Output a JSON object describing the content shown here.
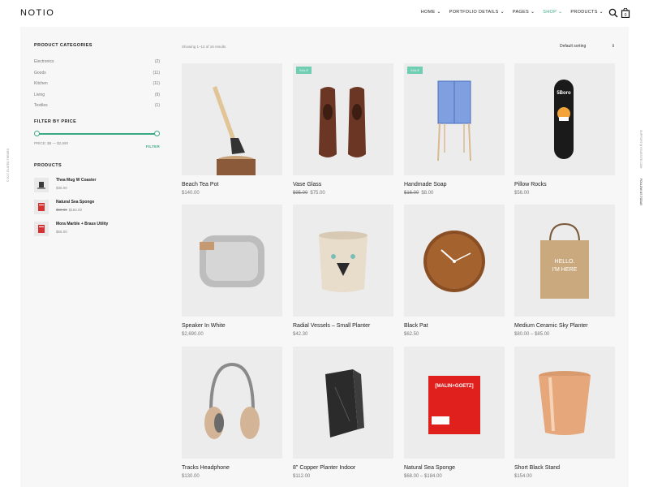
{
  "brand": {
    "logo": "NOTIO"
  },
  "nav": {
    "items": [
      {
        "label": "HOME"
      },
      {
        "label": "PORTFOLIO DETAILS"
      },
      {
        "label": "PAGES"
      },
      {
        "label": "SHOP"
      },
      {
        "label": "PRODUCTS"
      }
    ],
    "active_index": 3
  },
  "side_text": {
    "left": "© 2017 ELATED THEMES",
    "right_top": "SUPPORT@YOURSITE.COM",
    "right_bottom": "FOLLOW US TODAY"
  },
  "sidebar": {
    "categories_title": "PRODUCT CATEGORIES",
    "categories": [
      {
        "name": "Electronics",
        "count": "(2)"
      },
      {
        "name": "Goods",
        "count": "(11)"
      },
      {
        "name": "Kitchen",
        "count": "(11)"
      },
      {
        "name": "Living",
        "count": "(9)"
      },
      {
        "name": "Textiles",
        "count": "(1)"
      }
    ],
    "price_title": "FILTER BY PRICE",
    "price_range": "PRICE: $8 — $2,690",
    "filter_label": "FILTER",
    "products_title": "PRODUCTS",
    "products": [
      {
        "name": "Thea Mug W Coaster",
        "old_price": "",
        "price": "$35.00"
      },
      {
        "name": "Natural Sea Sponge",
        "old_price": "$68.00",
        "price": "$184.00"
      },
      {
        "name": "Mora Marble + Brass Utility",
        "old_price": "",
        "price": "$55.00"
      }
    ]
  },
  "shop": {
    "result_count": "Showing 1–12 of 16 results",
    "sorting": "Default sorting",
    "products": [
      {
        "name": "Beach Tea Pot",
        "old_price": "",
        "price": "$140.00",
        "badge": ""
      },
      {
        "name": "Vase Glass",
        "old_price": "$95.00",
        "price": "$75.00",
        "badge": "SALE"
      },
      {
        "name": "Handmade Soap",
        "old_price": "$16.00",
        "price": "$8.00",
        "badge": "SALE"
      },
      {
        "name": "Pillow Rocks",
        "old_price": "",
        "price": "$56.00",
        "badge": ""
      },
      {
        "name": "Speaker In White",
        "old_price": "",
        "price": "$2,690.00",
        "badge": ""
      },
      {
        "name": "Radial Vessels – Small Planter",
        "old_price": "",
        "price": "$42.30",
        "badge": ""
      },
      {
        "name": "Black Pat",
        "old_price": "",
        "price": "$62.50",
        "badge": ""
      },
      {
        "name": "Medium Ceramic Sky Planter",
        "old_price": "",
        "price": "$80.00 – $85.00",
        "badge": ""
      },
      {
        "name": "Tracks Headphone",
        "old_price": "",
        "price": "$130.00",
        "badge": ""
      },
      {
        "name": "8\" Copper Planter Indoor",
        "old_price": "",
        "price": "$112.00",
        "badge": ""
      },
      {
        "name": "Natural Sea Sponge",
        "old_price": "",
        "price": "$68.00 – $184.00",
        "badge": ""
      },
      {
        "name": "Short Black Stand",
        "old_price": "",
        "price": "$154.00",
        "badge": ""
      }
    ]
  },
  "colors": {
    "accent": "#3aa985",
    "sale_badge": "#6fcdb2",
    "frame_bg": "#f7f7f7",
    "image_bg": "#ececec"
  }
}
